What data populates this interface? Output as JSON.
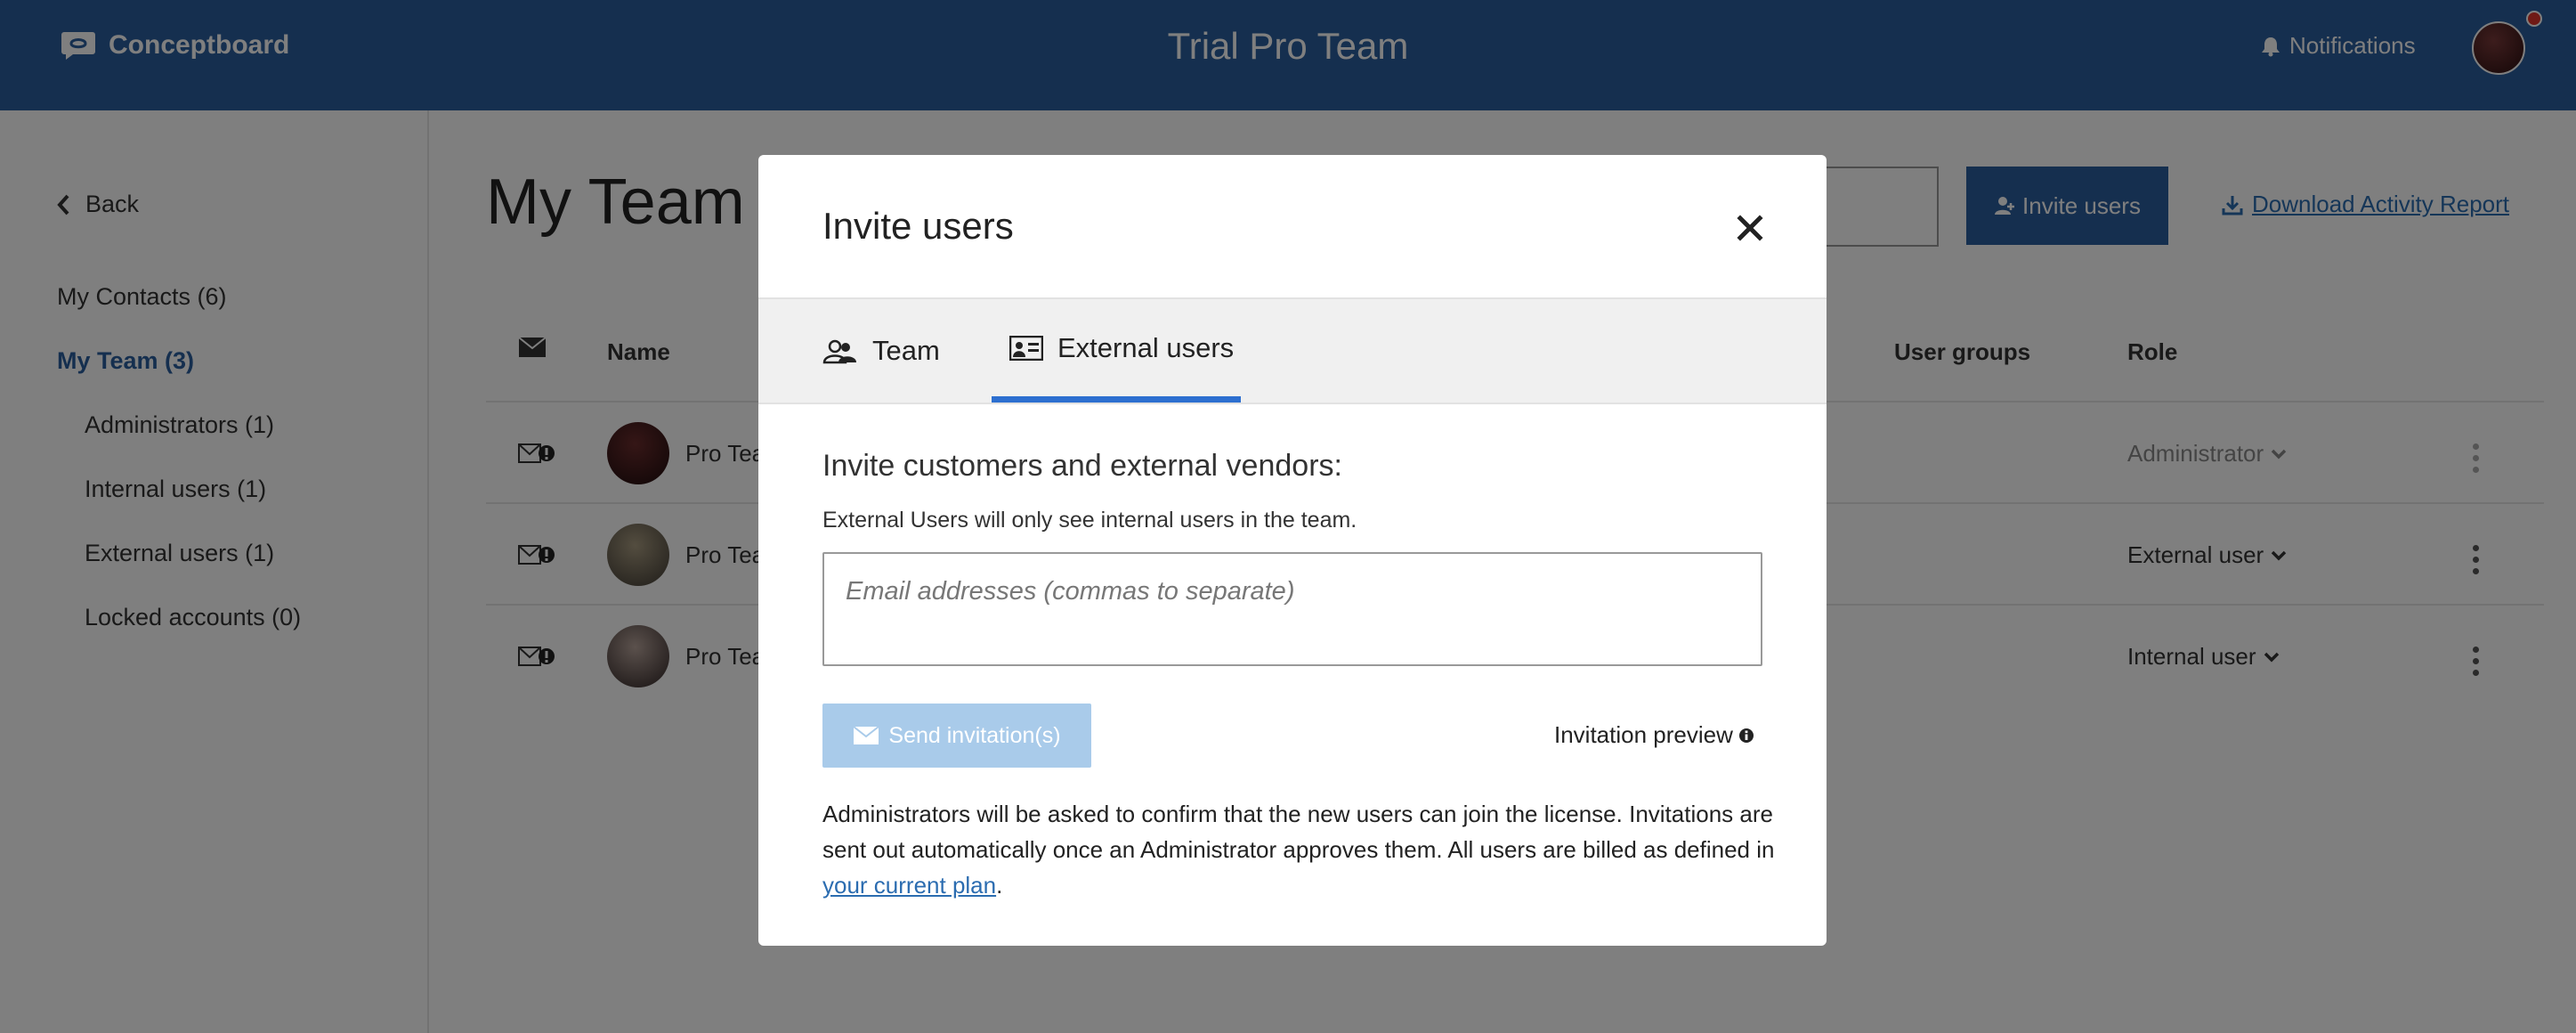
{
  "header": {
    "logo": "Conceptboard",
    "title": "Trial Pro Team",
    "notifications": "Notifications"
  },
  "sidebar": {
    "back": "Back",
    "items": [
      {
        "label": "My Contacts (6)"
      },
      {
        "label": "My Team (3)"
      },
      {
        "label": "Administrators (1)"
      },
      {
        "label": "Internal users (1)"
      },
      {
        "label": "External users (1)"
      },
      {
        "label": "Locked accounts (0)"
      }
    ]
  },
  "main": {
    "title": "My Team (",
    "invite_button": "Invite users",
    "download_link": "Download Activity Report",
    "columns": {
      "name": "Name",
      "groups": "User groups",
      "role": "Role"
    },
    "rows": [
      {
        "name": "Pro Tea",
        "role": "Administrator"
      },
      {
        "name": "Pro Tea",
        "role": "External user"
      },
      {
        "name": "Pro Tea",
        "role": "Internal user"
      }
    ]
  },
  "modal": {
    "title": "Invite users",
    "tabs": [
      {
        "label": "Team"
      },
      {
        "label": "External users"
      }
    ],
    "heading": "Invite customers and external vendors:",
    "subtext": "External Users will only see internal users in the team.",
    "email_placeholder": "Email addresses (commas to separate)",
    "send_button": "Send invitation(s)",
    "preview_link": "Invitation preview",
    "note_text": "Administrators will be asked to confirm that the new users can join the license. Invitations are sent out automatically once an Administrator approves them. All users are billed as defined in ",
    "note_link": "your current plan",
    "note_end": "."
  },
  "colors": {
    "header": "#2b5f9e",
    "accent": "#2d6fd0",
    "disabled_button": "#a9cbea"
  }
}
